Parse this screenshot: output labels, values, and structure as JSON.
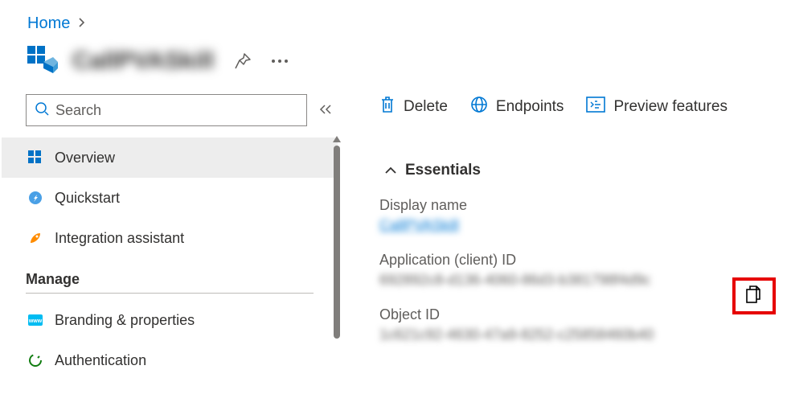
{
  "breadcrumb": {
    "home": "Home"
  },
  "title": "CallPVASkill",
  "search": {
    "placeholder": "Search"
  },
  "sidebar": {
    "items": [
      {
        "label": "Overview"
      },
      {
        "label": "Quickstart"
      },
      {
        "label": "Integration assistant"
      }
    ],
    "manage_header": "Manage",
    "manage_items": [
      {
        "label": "Branding & properties"
      },
      {
        "label": "Authentication"
      }
    ]
  },
  "toolbar": {
    "delete": "Delete",
    "endpoints": "Endpoints",
    "preview": "Preview features"
  },
  "essentials": {
    "header": "Essentials",
    "display_name_label": "Display name",
    "display_name_value": "CallPVASkill",
    "app_id_label": "Application (client) ID",
    "app_id_value": "692892c8-d136-4060-86d3-b381798f4d9c",
    "object_id_label": "Object ID",
    "object_id_value": "1c621c92-4630-47a9-8252-c25858460b40"
  }
}
